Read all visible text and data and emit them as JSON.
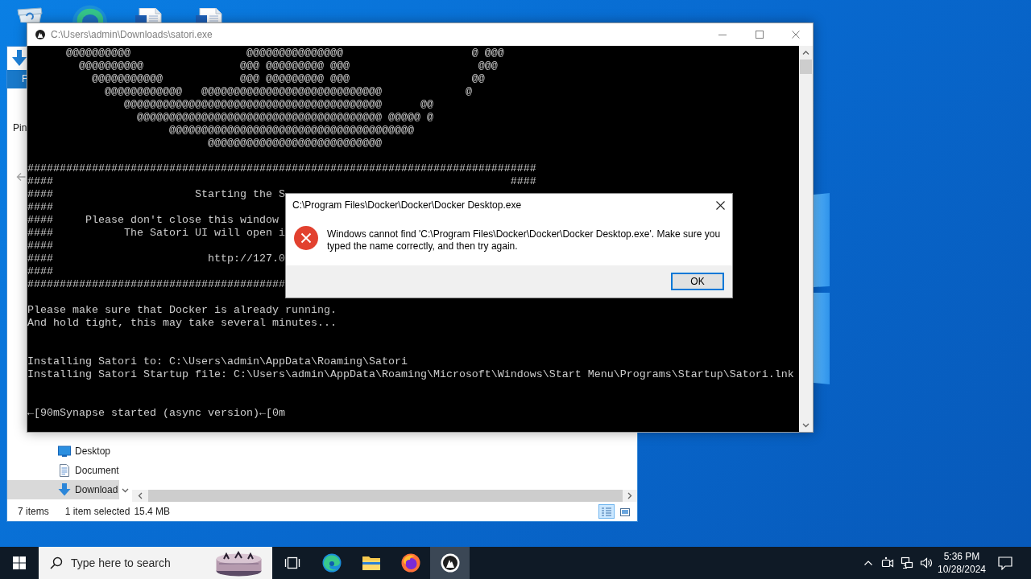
{
  "explorer": {
    "file_tab": "F",
    "ribbon_label": "Pin",
    "nav_items": [
      {
        "label": "Desktop",
        "kind": "desktop",
        "selected": false
      },
      {
        "label": "Document",
        "kind": "documents",
        "selected": false
      },
      {
        "label": "Download",
        "kind": "downloads",
        "selected": true
      }
    ],
    "status_bar": {
      "items": "7 items",
      "selection": "1 item selected",
      "size": "15.4 MB"
    },
    "view_buttons": [
      {
        "kind": "details",
        "selected": true
      },
      {
        "kind": "icons",
        "selected": false
      }
    ]
  },
  "console": {
    "title": "C:\\Users\\admin\\Downloads\\satori.exe",
    "lines": [
      {
        "kind": "text",
        "text": "      @@@@@@@@@@                  @@@@@@@@@@@@@@@                    @ @@@"
      },
      {
        "kind": "text",
        "text": "        @@@@@@@@@@               @@@ @@@@@@@@@ @@@                    @@@"
      },
      {
        "kind": "text",
        "text": "          @@@@@@@@@@@            @@@ @@@@@@@@@ @@@                   @@"
      },
      {
        "kind": "text",
        "text": "            @@@@@@@@@@@@   @@@@@@@@@@@@@@@@@@@@@@@@@@@@             @"
      },
      {
        "kind": "text",
        "text": "               @@@@@@@@@@@@@@@@@@@@@@@@@@@@@@@@@@@@@@@@      @@"
      },
      {
        "kind": "text",
        "text": "                 @@@@@@@@@@@@@@@@@@@@@@@@@@@@@@@@@@@@@@ @@@@@ @"
      },
      {
        "kind": "text",
        "text": "                      @@@@@@@@@@@@@@@@@@@@@@@@@@@@@@@@@@@@@@"
      },
      {
        "kind": "text",
        "text": "                            @@@@@@@@@@@@@@@@@@@@@@@@@@@"
      },
      {
        "kind": "blank"
      },
      {
        "kind": "text",
        "text": "###############################################################################"
      },
      {
        "kind": "text",
        "text": "####                                                                       ####"
      },
      {
        "kind": "text",
        "text": "####                      Starting the S"
      },
      {
        "kind": "text",
        "text": "####"
      },
      {
        "kind": "text",
        "text": "####     Please don't close this window"
      },
      {
        "kind": "text",
        "text": "####           The Satori UI will open i"
      },
      {
        "kind": "text",
        "text": "####"
      },
      {
        "kind": "text",
        "text": "####                        http://127.0"
      },
      {
        "kind": "text",
        "text": "####"
      },
      {
        "kind": "text",
        "text": "########################################"
      },
      {
        "kind": "blank"
      },
      {
        "kind": "text",
        "text": "Please make sure that Docker is already running."
      },
      {
        "kind": "text",
        "text": "And hold tight, this may take several minutes..."
      },
      {
        "kind": "blank"
      },
      {
        "kind": "blank"
      },
      {
        "kind": "text",
        "text": "Installing Satori to: C:\\Users\\admin\\AppData\\Roaming\\Satori"
      },
      {
        "kind": "text",
        "text": "Installing Satori Startup file: C:\\Users\\admin\\AppData\\Roaming\\Microsoft\\Windows\\Start Menu\\Programs\\Startup\\Satori.lnk"
      },
      {
        "kind": "blank"
      },
      {
        "kind": "blank"
      },
      {
        "kind": "text",
        "text": "←[90mSynapse started (async version)←[0m"
      }
    ]
  },
  "dialog": {
    "title": "C:\\Program Files\\Docker\\Docker\\Docker Desktop.exe",
    "message": "Windows cannot find 'C:\\Program Files\\Docker\\Docker\\Docker Desktop.exe'. Make sure you typed the name correctly, and then try again.",
    "buttons": [
      {
        "label": "OK",
        "default": true
      }
    ]
  },
  "taskbar": {
    "search": {
      "placeholder": "Type here to search"
    },
    "apps": [
      {
        "kind": "tasks",
        "selected": false
      },
      {
        "kind": "browser",
        "selected": false
      },
      {
        "kind": "folder",
        "selected": false
      },
      {
        "kind": "globe",
        "selected": false
      },
      {
        "kind": "console",
        "selected": true
      }
    ],
    "clock": {
      "time": "5:36 PM",
      "date": "10/28/2024"
    }
  }
}
